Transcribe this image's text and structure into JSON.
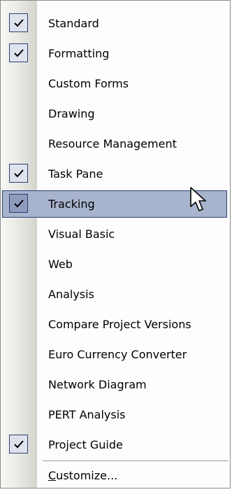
{
  "menu": {
    "items": [
      {
        "label": "Standard",
        "checked": true
      },
      {
        "label": "Formatting",
        "checked": true
      },
      {
        "label": "Custom Forms",
        "checked": false
      },
      {
        "label": "Drawing",
        "checked": false
      },
      {
        "label": "Resource Management",
        "checked": false
      },
      {
        "label": "Task Pane",
        "checked": true
      },
      {
        "label": "Tracking",
        "checked": true,
        "highlighted": true
      },
      {
        "label": "Visual Basic",
        "checked": false
      },
      {
        "label": "Web",
        "checked": false
      },
      {
        "label": "Analysis",
        "checked": false
      },
      {
        "label": "Compare Project Versions",
        "checked": false
      },
      {
        "label": "Euro Currency Converter",
        "checked": false
      },
      {
        "label": "Network Diagram",
        "checked": false
      },
      {
        "label": "PERT Analysis",
        "checked": false
      },
      {
        "label": "Project Guide",
        "checked": true
      }
    ],
    "customize": {
      "mnemonic": "C",
      "rest": "ustomize..."
    }
  },
  "colors": {
    "highlight": "#a8b3cd",
    "highlight_border": "#2b3f73",
    "checkbox_fill": "#dfe3ee"
  },
  "icons": {
    "check": "checkmark-icon",
    "cursor": "mouse-pointer-icon"
  }
}
